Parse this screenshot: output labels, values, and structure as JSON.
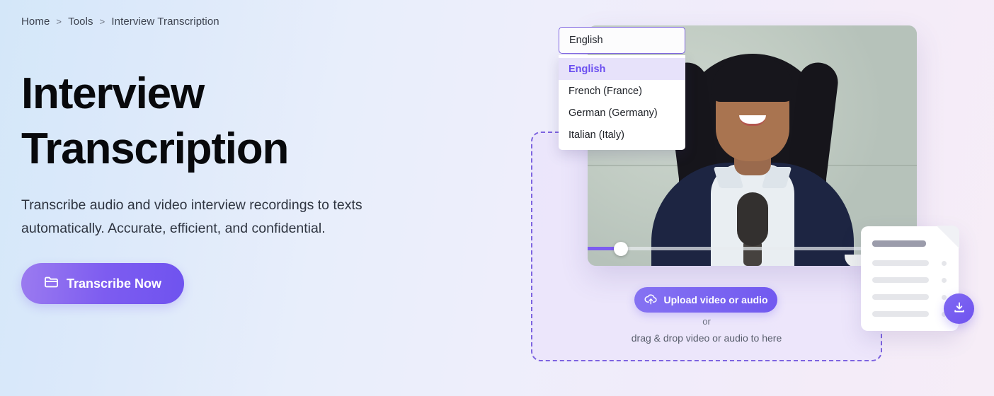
{
  "breadcrumb": {
    "items": [
      {
        "label": "Home"
      },
      {
        "label": "Tools"
      },
      {
        "label": "Interview Transcription"
      }
    ],
    "separator": ">"
  },
  "hero": {
    "title": "Interview Transcription",
    "subtitle": "Transcribe audio and video interview recordings to texts automatically. Accurate, efficient, and confidential.",
    "cta_label": "Transcribe Now",
    "cta_icon": "folder-icon"
  },
  "language_select": {
    "value": "English",
    "options": [
      {
        "label": "English",
        "selected": true
      },
      {
        "label": "French (France)",
        "selected": false
      },
      {
        "label": "German (Germany)",
        "selected": false
      },
      {
        "label": "Italian (Italy)",
        "selected": false
      }
    ]
  },
  "player": {
    "progress_percent": 10
  },
  "dropzone": {
    "upload_label": "Upload video or audio",
    "upload_icon": "cloud-upload-icon",
    "or_label": "or",
    "drag_label": "drag & drop video or audio to here"
  },
  "document_card": {
    "download_icon": "download-icon"
  },
  "colors": {
    "accent": "#7051f0",
    "accent_light": "#9b7bf0",
    "menu_highlight_bg": "#e7e2fa",
    "menu_highlight_text": "#6a4df0",
    "dashed_border": "#7d63e0",
    "heading": "#08090c",
    "body_text": "#2e3440"
  }
}
